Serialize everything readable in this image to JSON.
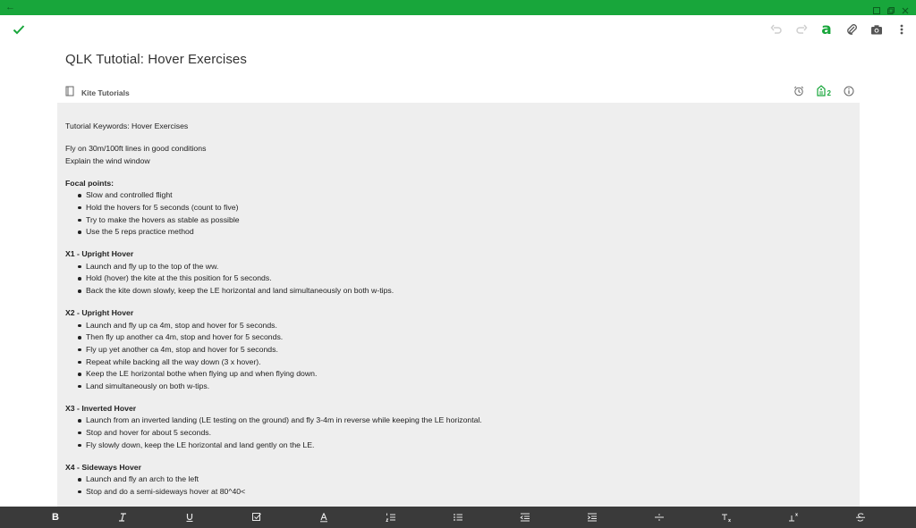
{
  "colors": {
    "accent": "#18a63b",
    "note_bg": "#eeeeee",
    "format_bar": "#3a3a3a"
  },
  "note": {
    "title": "QLK Tutotial: Hover Exercises",
    "notebook": "Kite Tutorials",
    "tag_count": "2",
    "body": {
      "keywords": "Tutorial Keywords: Hover Exercises",
      "intro": [
        "Fly on 30m/100ft lines in good conditions",
        "Explain the wind window"
      ],
      "sections": [
        {
          "heading": "Focal points:",
          "items": [
            "Slow and controlled flight",
            "Hold the hovers for 5 seconds (count to five)",
            "Try to make the hovers as stable as possible",
            "Use the 5 reps practice method"
          ]
        },
        {
          "heading": "X1 - Upright Hover",
          "items": [
            "Launch and fly up to the top of the ww.",
            "Hold (hover) the kite at the this position for 5 seconds.",
            "Back the kite down slowly, keep the LE horizontal and land simultaneously on both w-tips."
          ]
        },
        {
          "heading": "X2 - Upright Hover",
          "items": [
            "Launch and fly up ca 4m, stop and hover for 5 seconds.",
            "Then fly up another ca 4m, stop and hover for 5 seconds.",
            "Fly up yet another ca 4m, stop and hover for 5 seconds.",
            "Repeat while backing all the way down (3 x hover).",
            "Keep the LE horizontal bothe when flying up and when flying down.",
            "Land simultaneously on both w-tips."
          ]
        },
        {
          "heading": "X3 - Inverted Hover",
          "items": [
            "Launch from an inverted landing (LE testing on the ground) and fly 3-4m in reverse while keeping the LE horizontal.",
            "Stop and hover for about 5 seconds.",
            "Fly slowly down, keep the LE horizontal and land gently on the LE."
          ]
        },
        {
          "heading": "X4 - Sideways Hover",
          "items": [
            "Launch and fly an arch to the left",
            "Stop and do a semi-sideways hover at 80^40<"
          ]
        }
      ]
    }
  },
  "format_bar": {
    "bold": "B",
    "italic": "I",
    "underline": "U"
  }
}
